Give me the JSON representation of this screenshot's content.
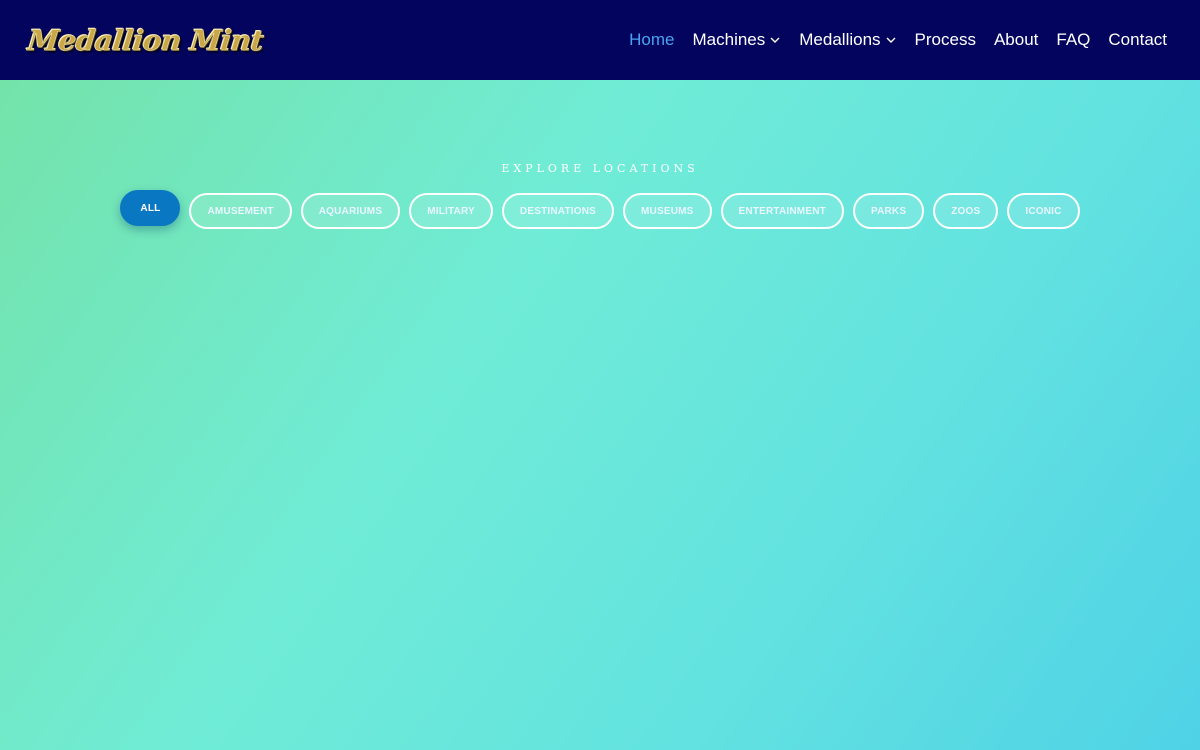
{
  "header": {
    "logo_text": "Medallion Mint",
    "nav": [
      {
        "label": "Home",
        "active": true,
        "dropdown": false
      },
      {
        "label": "Machines",
        "active": false,
        "dropdown": true
      },
      {
        "label": "Medallions",
        "active": false,
        "dropdown": true
      },
      {
        "label": "Process",
        "active": false,
        "dropdown": false
      },
      {
        "label": "About",
        "active": false,
        "dropdown": false
      },
      {
        "label": "FAQ",
        "active": false,
        "dropdown": false
      },
      {
        "label": "Contact",
        "active": false,
        "dropdown": false
      }
    ]
  },
  "locations": {
    "title": "EXPLORE LOCATIONS",
    "filters": [
      "ALL",
      "AMUSEMENT",
      "AQUARIUMS",
      "MILITARY",
      "DESTINATIONS",
      "MUSEUMS",
      "ENTERTAINMENT",
      "PARKS",
      "ZOOS",
      "ICONIC"
    ],
    "active_filter": "ALL"
  },
  "colors": {
    "header_bg": "#03045e",
    "nav_active": "#4aa3f0",
    "filter_active": "#0a77c2"
  }
}
